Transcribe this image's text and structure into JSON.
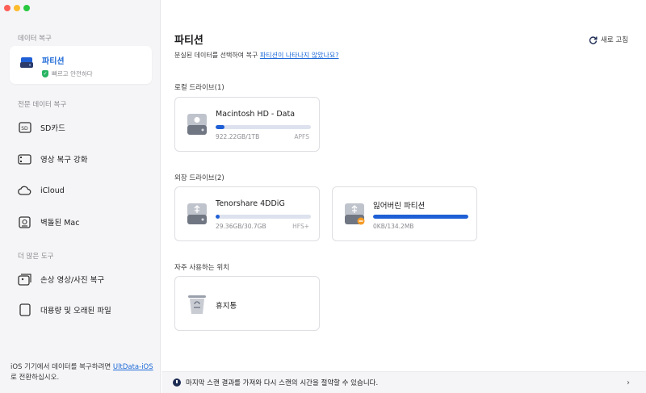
{
  "sidebar": {
    "section_recover": "데이터 복구",
    "selected": {
      "title": "파티션",
      "sub": "빠르고 안전하다"
    },
    "section_pro": "전문 데이터 복구",
    "items": [
      {
        "label": "SD카드",
        "icon": "sd-card-icon"
      },
      {
        "label": "영상 복구 강화",
        "icon": "video-icon"
      },
      {
        "label": "iCloud",
        "icon": "icloud-icon"
      },
      {
        "label": "벽돌된 Mac",
        "icon": "mac-icon"
      }
    ],
    "section_more": "더 많은 도구",
    "tools": [
      {
        "label": "손상 영상/사진 복구",
        "icon": "repair-icon"
      },
      {
        "label": "대용량 및 오래된 파일",
        "icon": "file-icon"
      }
    ],
    "footer": {
      "pre": "iOS 기기에서 데이터를 복구하려면 ",
      "link": "UltData-iOS",
      "post": "로 전환하십시오."
    }
  },
  "main": {
    "title": "파티션",
    "subtitle_text": "분실된 데이터를 선택하여 복구 ",
    "subtitle_link": "파티션이 나타나지 않았나요?",
    "refresh_label": "새로 고침",
    "local_label": "로컬 드라이브(1)",
    "external_label": "외장 드라이브(2)",
    "frequent_label": "자주 사용하는 위치",
    "local_drives": [
      {
        "name": "Macintosh HD - Data",
        "size": "922.22GB/1TB",
        "fs": "APFS",
        "usage": 0.09
      }
    ],
    "external_drives": [
      {
        "name": "Tenorshare 4DDiG",
        "size": "29.36GB/30.7GB",
        "fs": "HFS+",
        "usage": 0.04
      },
      {
        "name": "잃어버린 파티션",
        "size": "0KB/134.2MB",
        "fs": "",
        "usage": 1.0
      }
    ],
    "frequent": [
      {
        "name": "휴지통"
      }
    ],
    "bottom_text": "마지막 스캔 결과를 가져와 다시 스캔의 시간을 절약할 수 있습니다."
  },
  "colors": {
    "accent": "#1f6ad8",
    "bar_fill": "#1f5fd6",
    "sidebar_bg": "#f5f5f7"
  }
}
